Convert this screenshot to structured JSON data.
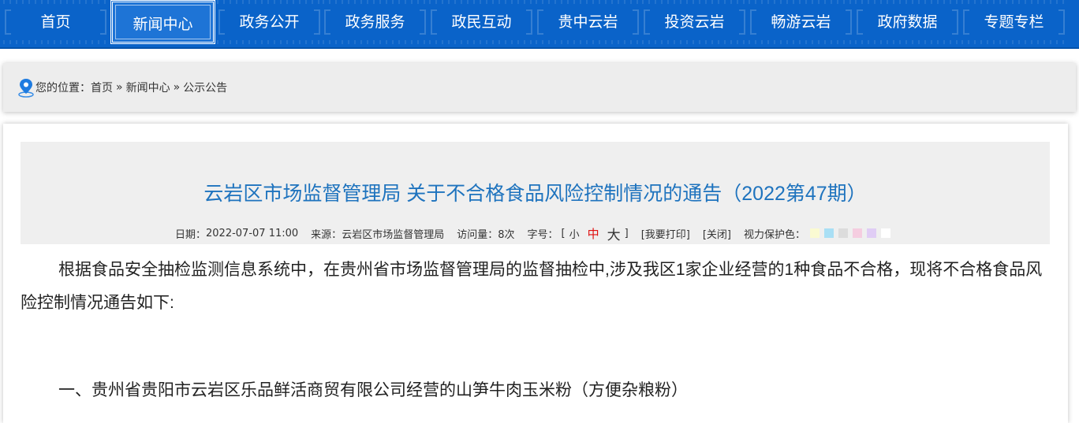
{
  "nav": {
    "items": [
      {
        "label": "首页"
      },
      {
        "label": "新闻中心"
      },
      {
        "label": "政务公开"
      },
      {
        "label": "政务服务"
      },
      {
        "label": "政民互动"
      },
      {
        "label": "贵中云岩"
      },
      {
        "label": "投资云岩"
      },
      {
        "label": "畅游云岩"
      },
      {
        "label": "政府数据"
      },
      {
        "label": "专题专栏"
      }
    ],
    "active_index": 1,
    "bg_color": "#0a63c9"
  },
  "breadcrumb": {
    "prefix": "您的位置：",
    "items": [
      "首页",
      "新闻中心",
      "公示公告"
    ],
    "separator": "»",
    "icon": "location-pin-icon"
  },
  "article": {
    "title": "云岩区市场监督管理局 关于不合格食品风险控制情况的通告（2022第47期）",
    "meta": {
      "date_label": "日期：",
      "date": "2022-07-07 11:00",
      "source_label": "来源：",
      "source": "云岩区市场监督管理局",
      "visits_label": "访问量：",
      "visits": "8次",
      "font_label": "字号：",
      "bracket_open": "[",
      "bracket_close": "]",
      "font_small": "小",
      "font_medium": "中",
      "font_large": "大",
      "print": "[我要打印]",
      "close": "[关闭]",
      "eye_label": "视力保护色：",
      "eye_colors": [
        "#fafad2",
        "#a9dff5",
        "#dcdcdc",
        "#f5cde0",
        "#e0cdf5",
        "#ffffff"
      ]
    },
    "paragraphs": [
      "根据食品安全抽检监测信息系统中，在贵州省市场监督管理局的监督抽检中,涉及我区1家企业经营的1种食品不合格，现将不合格食品风险控制情况通告如下:",
      "一、贵州省贵阳市云岩区乐品鲜活商贸有限公司经营的山笋牛肉玉米粉（方便杂粮粉）"
    ]
  }
}
